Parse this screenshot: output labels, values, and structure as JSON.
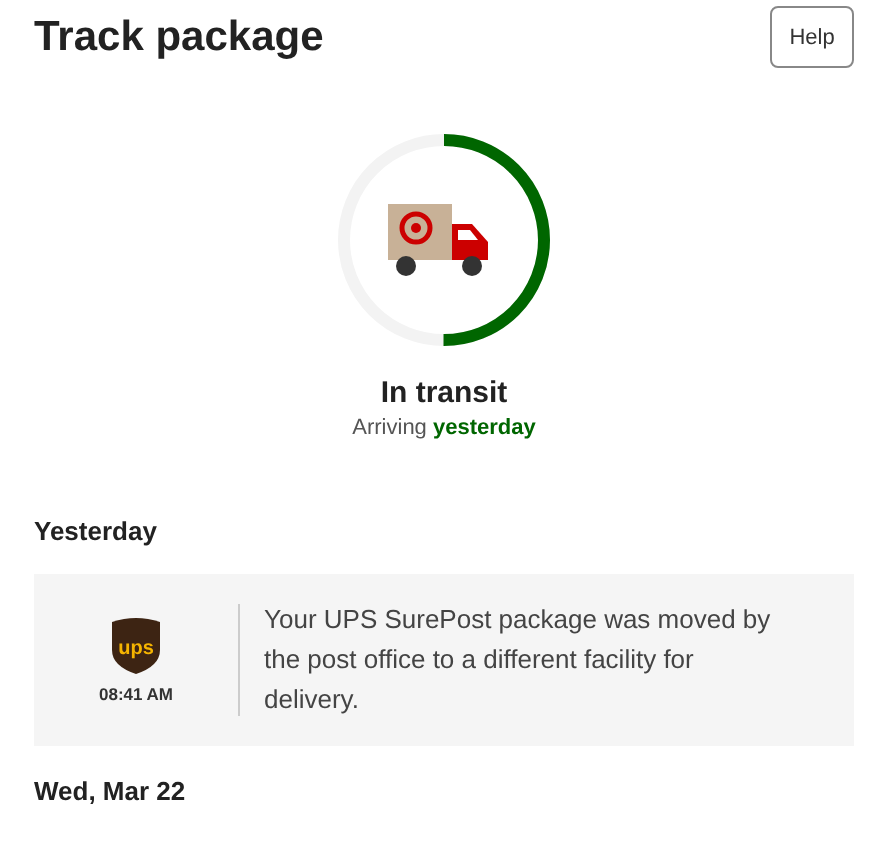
{
  "header": {
    "title": "Track package",
    "help_button": "Help"
  },
  "progress": {
    "level": 0.5,
    "status": "In transit",
    "arrival_prefix": "Arriving",
    "arrival_value": "yesterday"
  },
  "events": [
    {
      "date": "Yesterday",
      "items": [
        {
          "carrier_logo": "ups",
          "time": "08:41 AM",
          "message": "Your UPS SurePost package was moved by the post office to a different facility for delivery."
        }
      ]
    },
    {
      "date": "Wed, Mar 22"
    }
  ]
}
